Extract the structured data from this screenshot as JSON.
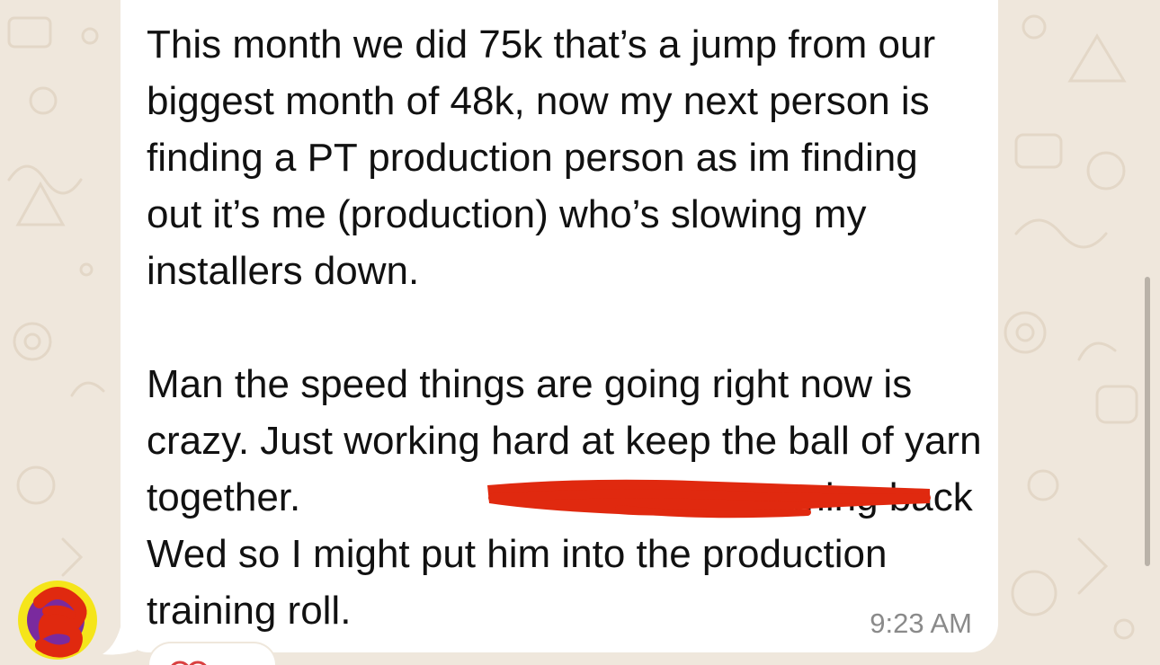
{
  "chat": {
    "message": {
      "paragraph_1": "This month we did 75k that’s a jump from our biggest month of 48k, now my next person is finding a PT production person as im finding out it’s me (production) who’s slowing my installers down.",
      "paragraph_2_before_redaction": "Man the speed things are going right now is crazy. Just working hard at keep the ball of yarn together. ",
      "paragraph_2_after_redaction": " coming back Wed so I might put him into the production training roll.",
      "timestamp": "9:23 AM"
    },
    "sender": {
      "avatar_icon": "redacted-avatar-icon"
    },
    "reaction": {
      "icon": "reaction-icon"
    },
    "colors": {
      "background": "#efe7dc",
      "bubble": "#ffffff",
      "text": "#111111",
      "timestamp": "#8a8a8a",
      "redaction": "#e0290f",
      "avatar_highlight": "#f5e51a",
      "avatar_purple": "#7a2a9e"
    }
  }
}
